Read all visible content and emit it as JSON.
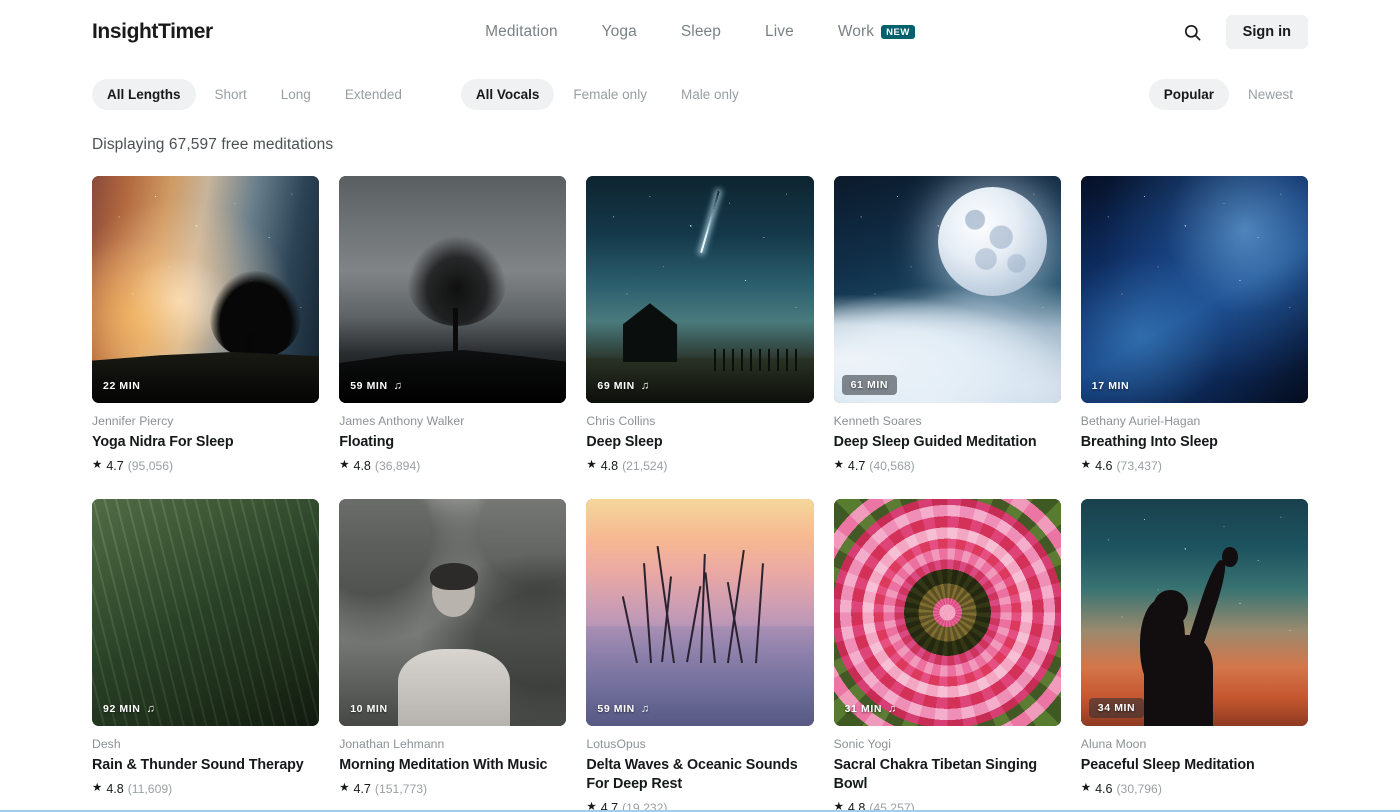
{
  "header": {
    "logo": "InsightTimer",
    "nav": [
      {
        "label": "Meditation",
        "badge": null
      },
      {
        "label": "Yoga",
        "badge": null
      },
      {
        "label": "Sleep",
        "badge": null
      },
      {
        "label": "Live",
        "badge": null
      },
      {
        "label": "Work",
        "badge": "NEW"
      }
    ],
    "search_icon": "search-icon",
    "sign_in_label": "Sign in",
    "badge_color": "#00606b"
  },
  "filters": {
    "length": [
      {
        "label": "All Lengths",
        "active": true
      },
      {
        "label": "Short",
        "active": false
      },
      {
        "label": "Long",
        "active": false
      },
      {
        "label": "Extended",
        "active": false
      }
    ],
    "vocals": [
      {
        "label": "All Vocals",
        "active": true
      },
      {
        "label": "Female only",
        "active": false
      },
      {
        "label": "Male only",
        "active": false
      }
    ],
    "sort": [
      {
        "label": "Popular",
        "active": true
      },
      {
        "label": "Newest",
        "active": false
      }
    ]
  },
  "results": {
    "count_text": "Displaying 67,597 free meditations"
  },
  "cards": [
    {
      "author": "Jennifer Piercy",
      "title": "Yoga Nidra For Sleep",
      "rating": "4.7",
      "rating_count": "(95,056)",
      "duration": "22 MIN",
      "has_music": false,
      "boxed_badge": false,
      "art": "art-stars-tree",
      "art_name": "starry-sky-tree-artwork"
    },
    {
      "author": "James Anthony Walker",
      "title": "Floating",
      "rating": "4.8",
      "rating_count": "(36,894)",
      "duration": "59 MIN",
      "has_music": true,
      "boxed_badge": false,
      "art": "art-bare-tree",
      "art_name": "bare-tree-silhouette-artwork"
    },
    {
      "author": "Chris Collins",
      "title": "Deep Sleep",
      "rating": "4.8",
      "rating_count": "(21,524)",
      "duration": "69 MIN",
      "has_music": true,
      "boxed_badge": false,
      "art": "art-comet",
      "art_name": "night-barn-comet-artwork"
    },
    {
      "author": "Kenneth Soares",
      "title": "Deep Sleep Guided Meditation",
      "rating": "4.7",
      "rating_count": "(40,568)",
      "duration": "61 MIN",
      "has_music": false,
      "boxed_badge": true,
      "art": "art-moon",
      "art_name": "full-moon-clouds-artwork"
    },
    {
      "author": "Bethany Auriel-Hagan",
      "title": "Breathing Into Sleep",
      "rating": "4.6",
      "rating_count": "(73,437)",
      "duration": "17 MIN",
      "has_music": false,
      "boxed_badge": false,
      "art": "art-nebula",
      "art_name": "blue-nebula-artwork"
    },
    {
      "author": "Desh",
      "title": "Rain & Thunder Sound Therapy",
      "rating": "4.8",
      "rating_count": "(11,609)",
      "duration": "92 MIN",
      "has_music": true,
      "boxed_badge": false,
      "art": "art-grass",
      "art_name": "green-grass-dew-artwork"
    },
    {
      "author": "Jonathan Lehmann",
      "title": "Morning Meditation With Music",
      "rating": "4.7",
      "rating_count": "(151,773)",
      "duration": "10 MIN",
      "has_music": false,
      "boxed_badge": false,
      "art": "art-portrait",
      "art_name": "portrait-man-park-artwork"
    },
    {
      "author": "LotusOpus",
      "title": "Delta Waves & Oceanic Sounds For Deep Rest",
      "rating": "4.7",
      "rating_count": "(19,232)",
      "duration": "59 MIN",
      "has_music": true,
      "boxed_badge": false,
      "art": "art-reeds",
      "art_name": "reeds-water-dusk-artwork"
    },
    {
      "author": "Sonic Yogi",
      "title": "Sacral Chakra Tibetan Singing Bowl",
      "rating": "4.8",
      "rating_count": "(45,257)",
      "duration": "31 MIN",
      "has_music": true,
      "boxed_badge": false,
      "art": "art-mandala",
      "art_name": "pink-flower-mandala-artwork"
    },
    {
      "author": "Aluna Moon",
      "title": "Peaceful Sleep Meditation",
      "rating": "4.6",
      "rating_count": "(30,796)",
      "duration": "34 MIN",
      "has_music": false,
      "boxed_badge": true,
      "art": "art-sunset-fig",
      "art_name": "silhouette-sunset-artwork"
    }
  ],
  "glyphs": {
    "star": "★",
    "music_note": "♫"
  }
}
